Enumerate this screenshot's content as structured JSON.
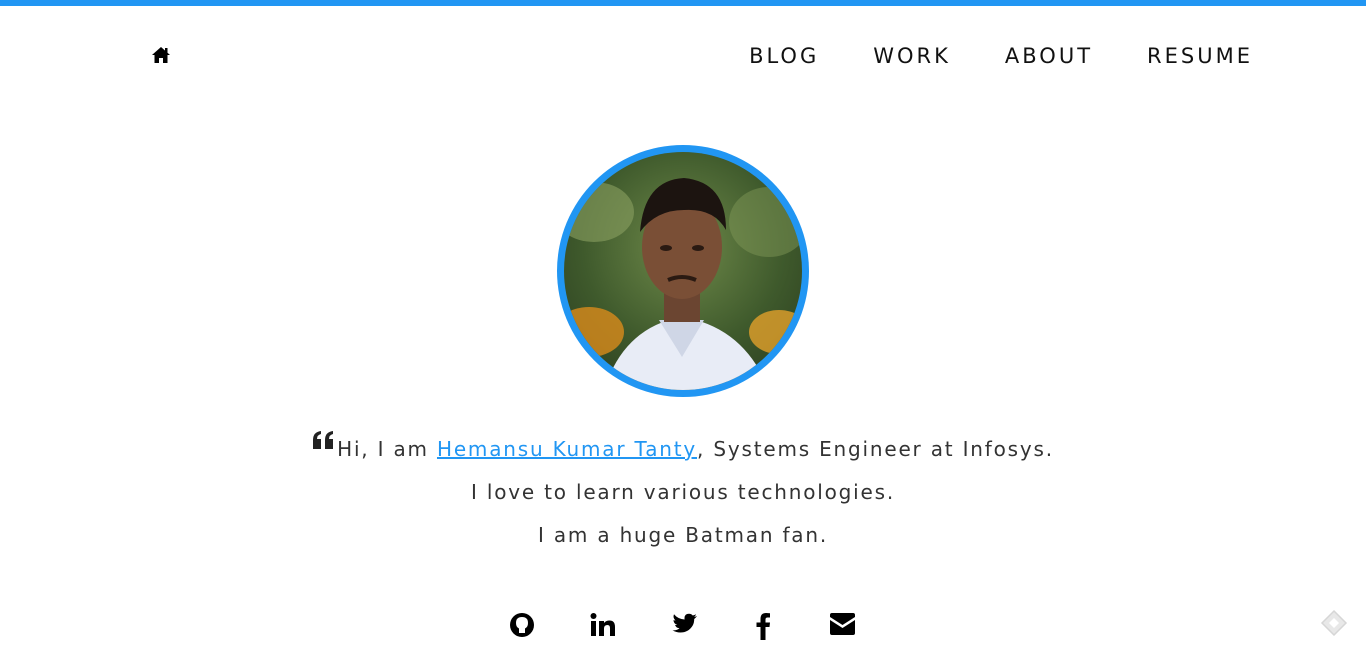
{
  "nav": {
    "home_icon": "home-icon",
    "links": [
      "BLOG",
      "WORK",
      "ABOUT",
      "RESUME"
    ]
  },
  "profile": {
    "avatar_description": "profile-photo",
    "accent_color": "#2196f3"
  },
  "intro": {
    "line1_prefix": "Hi, I am ",
    "name": "Hemansu Kumar Tanty",
    "line1_suffix": ", Systems Engineer at Infosys.",
    "line2": "I love to learn various technologies.",
    "line3": "I am a huge Batman fan."
  },
  "social": {
    "icons": [
      "github-icon",
      "linkedin-icon",
      "twitter-icon",
      "facebook-icon",
      "email-icon"
    ]
  },
  "colors": {
    "accent": "#2196f3",
    "text": "#333333",
    "nav_text": "#111111"
  }
}
